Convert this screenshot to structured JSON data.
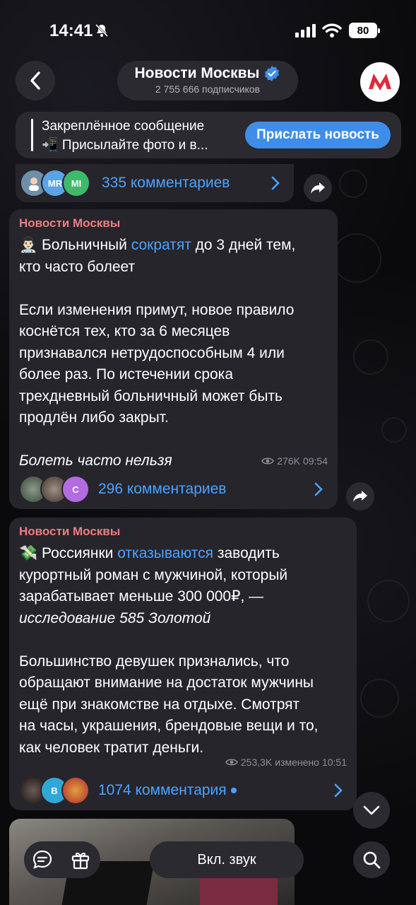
{
  "status": {
    "time": "14:41",
    "battery": "80"
  },
  "header": {
    "title": "Новости Москвы",
    "subscribers": "2 755 666 подписчиков"
  },
  "pinned": {
    "title": "Закреплённое сообщение",
    "text": "📲 Присылайте фото и в...",
    "button": "Прислать новость"
  },
  "top_comments": {
    "label": "335 комментариев",
    "avatars": [
      "",
      "MR",
      "MI"
    ]
  },
  "posts": [
    {
      "sender": "Новости Москвы",
      "emoji": "👨🏻‍⚕️",
      "line1_pre": "Больничный ",
      "line1_link": "сократят",
      "line1_post": " до 3 дней тем,",
      "line2": "кто часто болеет",
      "p2": [
        "Если изменения примут, новое правило",
        "коснётся тех, кто за 6 месяцев",
        "признавался нетрудоспособным 4 или",
        "более раз. По истечении срока",
        "трехдневный больничный может быть",
        "продлён либо закрыт."
      ],
      "p3_italic": "Болеть часто нельзя",
      "views": "276K",
      "time": "09:54",
      "comments": "296 комментариев",
      "avatars": [
        "",
        "",
        "C"
      ]
    },
    {
      "sender": "Новости Москвы",
      "emoji": "💸",
      "line1_pre": "Россиянки ",
      "line1_link": "отказываются",
      "line1_post": " заводить",
      "line2": "курортный роман с мужчиной, который",
      "line3": "зарабатывает меньше 300 000₽, —",
      "line4_italic": "исследование 585 Золотой",
      "p2": [
        "Большинство девушек признались, что",
        "обращают внимание на достаток мужчины",
        "ещё при знакомстве на отдыхе. Смотрят",
        "на часы, украшения, брендовые вещи и то,",
        "как человек тратит деньги."
      ],
      "views": "253,3K",
      "edited": "изменено",
      "time": "10:51",
      "comments": "1074 комментария",
      "avatars": [
        "",
        "B",
        ""
      ]
    }
  ],
  "bottom": {
    "sound_label": "Вкл. звук"
  },
  "colors": {
    "accent": "#4aa3ff",
    "sender": "#ef7d7d",
    "bubble": "#26252c",
    "pill": "#2b2a31",
    "button": "#3e8ee9"
  }
}
